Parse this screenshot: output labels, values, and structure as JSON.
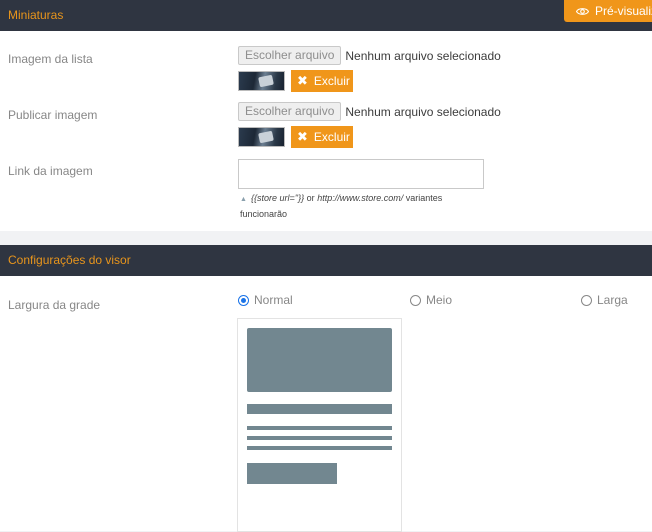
{
  "header1": {
    "title": "Miniaturas"
  },
  "preview_button": {
    "label": "Pré-visualizar",
    "icon": "eye-icon"
  },
  "fields": {
    "list_image": {
      "label": "Imagem da lista",
      "choose_label": "Escolher arquivo",
      "file_status": "Nenhum arquivo selecionado",
      "delete_label": "Excluir"
    },
    "publish_image": {
      "label": "Publicar imagem",
      "choose_label": "Escolher arquivo",
      "file_status": "Nenhum arquivo selecionado",
      "delete_label": "Excluir"
    },
    "image_link": {
      "label": "Link da imagem",
      "value": "",
      "hint_code1": "{{store url=''}}",
      "hint_or": " or ",
      "hint_code2": "http://www.store.com/",
      "hint_rest": " variantes funcionarão"
    }
  },
  "header2": {
    "title": "Configurações do visor"
  },
  "grid_width": {
    "label": "Largura da grade",
    "options": [
      {
        "label": "Normal",
        "checked": true
      },
      {
        "label": "Meio",
        "checked": false
      },
      {
        "label": "Larga",
        "checked": false
      }
    ]
  },
  "colors": {
    "accent": "#f0961a",
    "header_bg": "#2f3541",
    "header_text": "#e8951c",
    "placeholder": "#728790"
  }
}
